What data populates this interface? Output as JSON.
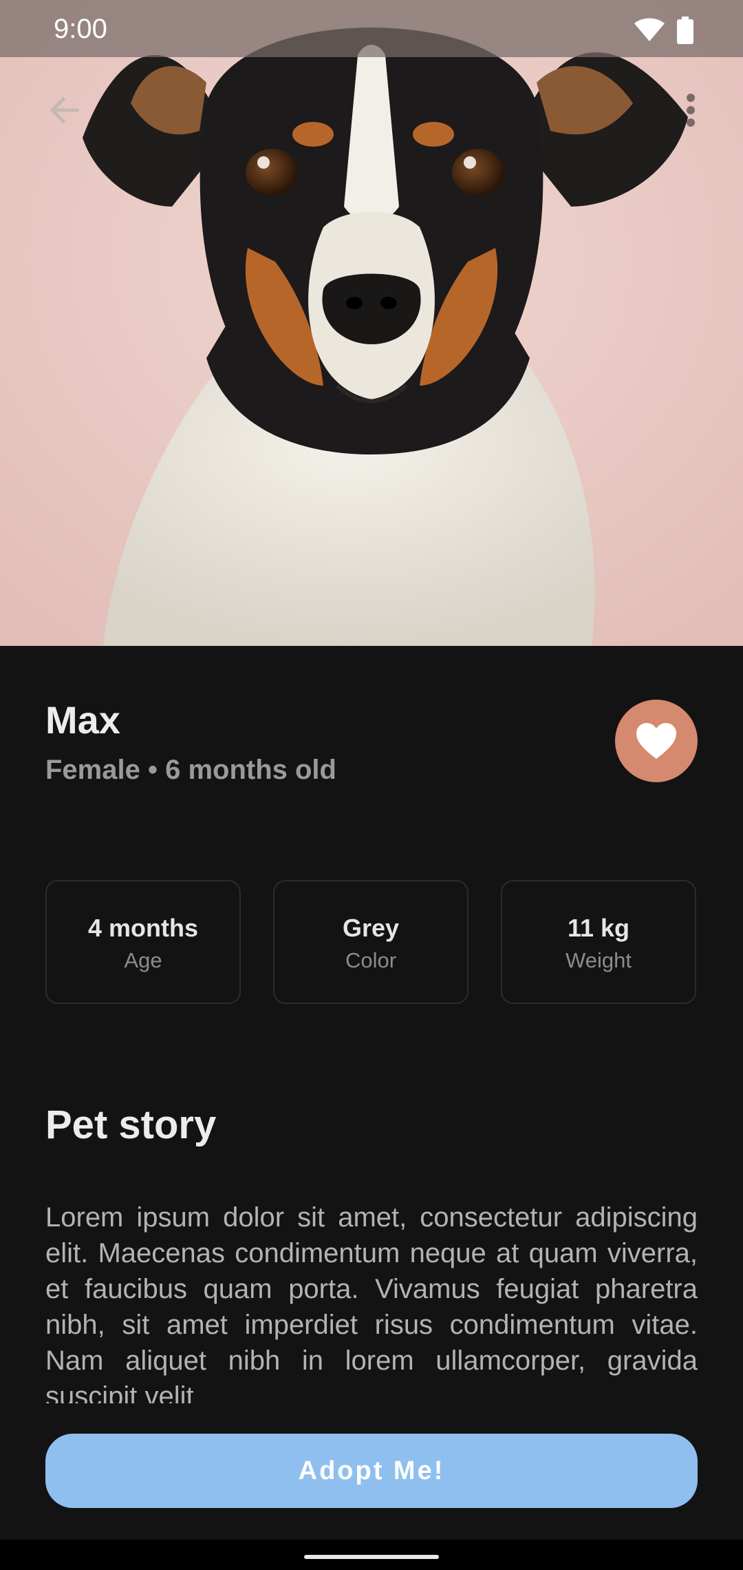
{
  "status_bar": {
    "time": "9:00",
    "icons": [
      "wifi-icon",
      "battery-icon"
    ]
  },
  "app_bar": {
    "back_icon": "arrow-back-icon",
    "more_icon": "more-vert-icon"
  },
  "pet": {
    "name": "Max",
    "subtitle": "Female • 6 months old",
    "favorite_icon": "heart-icon"
  },
  "stats": [
    {
      "value": "4 months",
      "label": "Age"
    },
    {
      "value": "Grey",
      "label": "Color"
    },
    {
      "value": "11 kg",
      "label": "Weight"
    }
  ],
  "story": {
    "title": "Pet story",
    "text": "Lorem ipsum dolor sit amet, consectetur adipiscing elit. Maecenas condimentum neque at quam viverra, et faucibus quam porta. Vivamus feugiat pharetra nibh, sit amet imperdiet risus condimentum vitae. Nam aliquet nibh in lorem ullamcorper, gravida suscipit velit"
  },
  "actions": {
    "adopt_label": "Adopt Me!"
  },
  "colors": {
    "background": "#131313",
    "accent_favorite": "#d5896e",
    "adopt_button": "#8fbfee",
    "hero_backdrop": "#e9cbc6"
  }
}
